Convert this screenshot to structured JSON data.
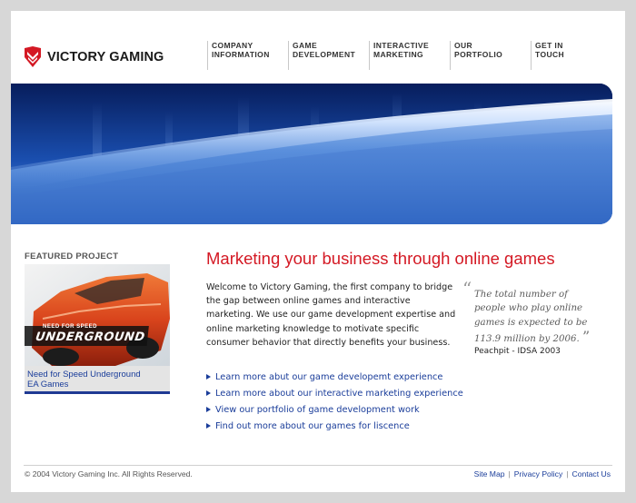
{
  "brand": {
    "name": "VICTORY GAMING",
    "logo_icon": "victory-chevron-shield",
    "accent": "#d41924"
  },
  "nav": [
    {
      "line1": "COMPANY",
      "line2": "INFORMATION"
    },
    {
      "line1": "GAME",
      "line2": "DEVELOPMENT"
    },
    {
      "line1": "INTERACTIVE",
      "line2": "MARKETING"
    },
    {
      "line1": "OUR",
      "line2": "PORTFOLIO"
    },
    {
      "line1": "GET IN",
      "line2": "TOUCH"
    }
  ],
  "featured": {
    "heading": "FEATURED PROJECT",
    "image_text_top": "NEED FOR SPEED",
    "image_text_main": "UNDERGROUND",
    "caption_title": "Need for Speed Underground",
    "caption_publisher": "EA Games"
  },
  "main": {
    "heading": "Marketing your business through online games",
    "intro": "Welcome to Victory Gaming, the first company to bridge the gap between online games and interactive marketing. We use our game development expertise and online marketing knowledge to motivate specific consumer behavior that directly benefits your business.",
    "links": [
      "Learn more abut our game developemt experience",
      "Learn more about our interactive marketing experience",
      "View our portfolio of game development work",
      "Find out more about our games for liscence"
    ]
  },
  "quote": {
    "open_mark": "“",
    "text": "The total number of people who play online games is expected to be 113.9 million by 2006.",
    "close_mark": "”",
    "attribution": "Peachpit - IDSA 2003"
  },
  "footer": {
    "copyright": "© 2004 Victory Gaming Inc. All Rights Reserved.",
    "links": [
      "Site Map",
      "Privacy Policy",
      "Contact Us"
    ],
    "separator": "|"
  },
  "colors": {
    "link": "#1a3d9a",
    "banner_space": "#0c2a72",
    "caption_bar": "#1f3a93"
  }
}
